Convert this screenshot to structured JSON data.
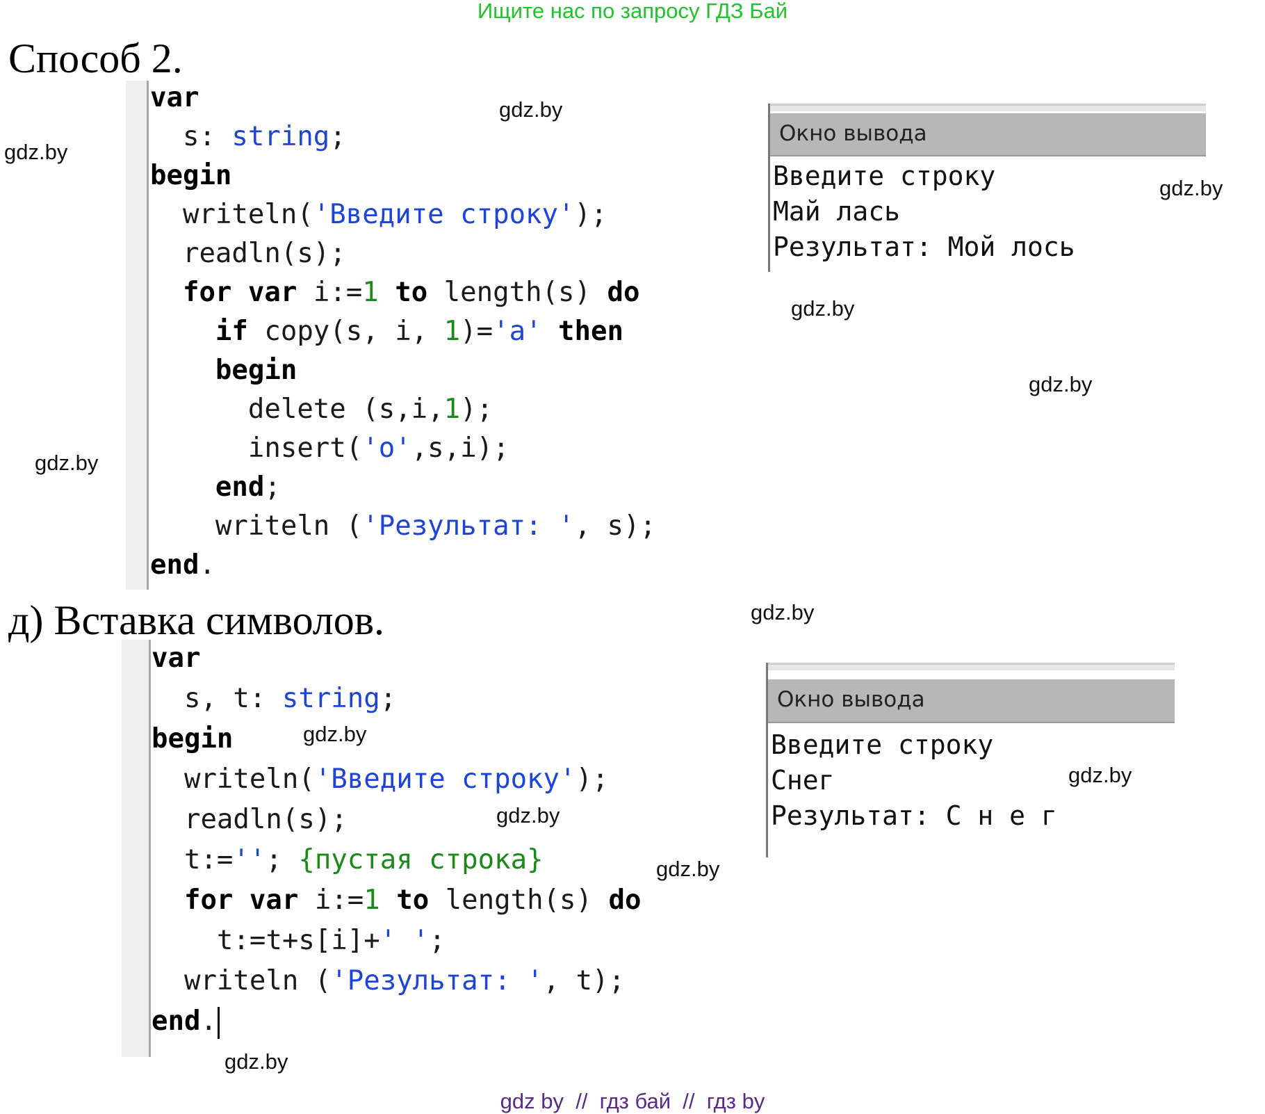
{
  "banner": "Ищите нас по запросу ГДЗ Бай",
  "section1_title": "Способ 2.",
  "section2_title": "д) Вставка символов.",
  "watermark": "gdz.by",
  "footer": "gdz by  //  гдз бай  //  гдз by",
  "program1": [
    [
      [
        "kw",
        "var"
      ]
    ],
    [
      [
        "t",
        "  s: "
      ],
      [
        "ty",
        "string"
      ],
      [
        "t",
        ";"
      ]
    ],
    [
      [
        "kw",
        "begin"
      ]
    ],
    [
      [
        "t",
        "  writeln("
      ],
      [
        "st",
        "'Введите строку'"
      ],
      [
        "t",
        ");"
      ]
    ],
    [
      [
        "t",
        "  readln(s);"
      ]
    ],
    [
      [
        "t",
        "  "
      ],
      [
        "kw",
        "for var"
      ],
      [
        "t",
        " i:="
      ],
      [
        "nu",
        "1"
      ],
      [
        "t",
        " "
      ],
      [
        "kw",
        "to"
      ],
      [
        "t",
        " length(s) "
      ],
      [
        "kw",
        "do"
      ]
    ],
    [
      [
        "t",
        "    "
      ],
      [
        "kw",
        "if"
      ],
      [
        "t",
        " copy(s, i, "
      ],
      [
        "nu",
        "1"
      ],
      [
        "t",
        ")="
      ],
      [
        "st",
        "'a'"
      ],
      [
        "t",
        " "
      ],
      [
        "kw",
        "then"
      ]
    ],
    [
      [
        "t",
        "    "
      ],
      [
        "kw",
        "begin"
      ]
    ],
    [
      [
        "t",
        "      delete (s,i,"
      ],
      [
        "nu",
        "1"
      ],
      [
        "t",
        ");"
      ]
    ],
    [
      [
        "t",
        "      insert("
      ],
      [
        "st",
        "'o'"
      ],
      [
        "t",
        ",s,i);"
      ]
    ],
    [
      [
        "t",
        "    "
      ],
      [
        "kw",
        "end"
      ],
      [
        "t",
        ";"
      ]
    ],
    [
      [
        "t",
        "    writeln ("
      ],
      [
        "st",
        "'Результат: '"
      ],
      [
        "t",
        ", s);"
      ]
    ],
    [
      [
        "kw",
        "end"
      ],
      [
        "t",
        "."
      ]
    ]
  ],
  "program2": [
    [
      [
        "kw",
        "var"
      ]
    ],
    [
      [
        "t",
        "  s, t: "
      ],
      [
        "ty",
        "string"
      ],
      [
        "t",
        ";"
      ]
    ],
    [
      [
        "kw",
        "begin"
      ]
    ],
    [
      [
        "t",
        "  writeln("
      ],
      [
        "st",
        "'Введите строку'"
      ],
      [
        "t",
        ");"
      ]
    ],
    [
      [
        "t",
        "  readln(s);"
      ]
    ],
    [
      [
        "t",
        "  t:="
      ],
      [
        "st",
        "''"
      ],
      [
        "t",
        "; "
      ],
      [
        "cm",
        "{пустая строка}"
      ]
    ],
    [
      [
        "t",
        "  "
      ],
      [
        "kw",
        "for var"
      ],
      [
        "t",
        " i:="
      ],
      [
        "nu",
        "1"
      ],
      [
        "t",
        " "
      ],
      [
        "kw",
        "to"
      ],
      [
        "t",
        " length(s) "
      ],
      [
        "kw",
        "do"
      ]
    ],
    [
      [
        "t",
        "    t:=t+s[i]+"
      ],
      [
        "st",
        "' '"
      ],
      [
        "t",
        ";"
      ]
    ],
    [
      [
        "t",
        "  writeln ("
      ],
      [
        "st",
        "'Результат: '"
      ],
      [
        "t",
        ", t);"
      ]
    ],
    [
      [
        "kw",
        "end"
      ],
      [
        "t",
        "."
      ]
    ]
  ],
  "output1": {
    "title": "Окно вывода",
    "lines": [
      "Введите строку",
      "Май лась",
      "Результат: Мой лось"
    ]
  },
  "output2": {
    "title": "Окно вывода",
    "lines": [
      "Введите строку",
      "Снег",
      "Результат: С н е г"
    ]
  }
}
